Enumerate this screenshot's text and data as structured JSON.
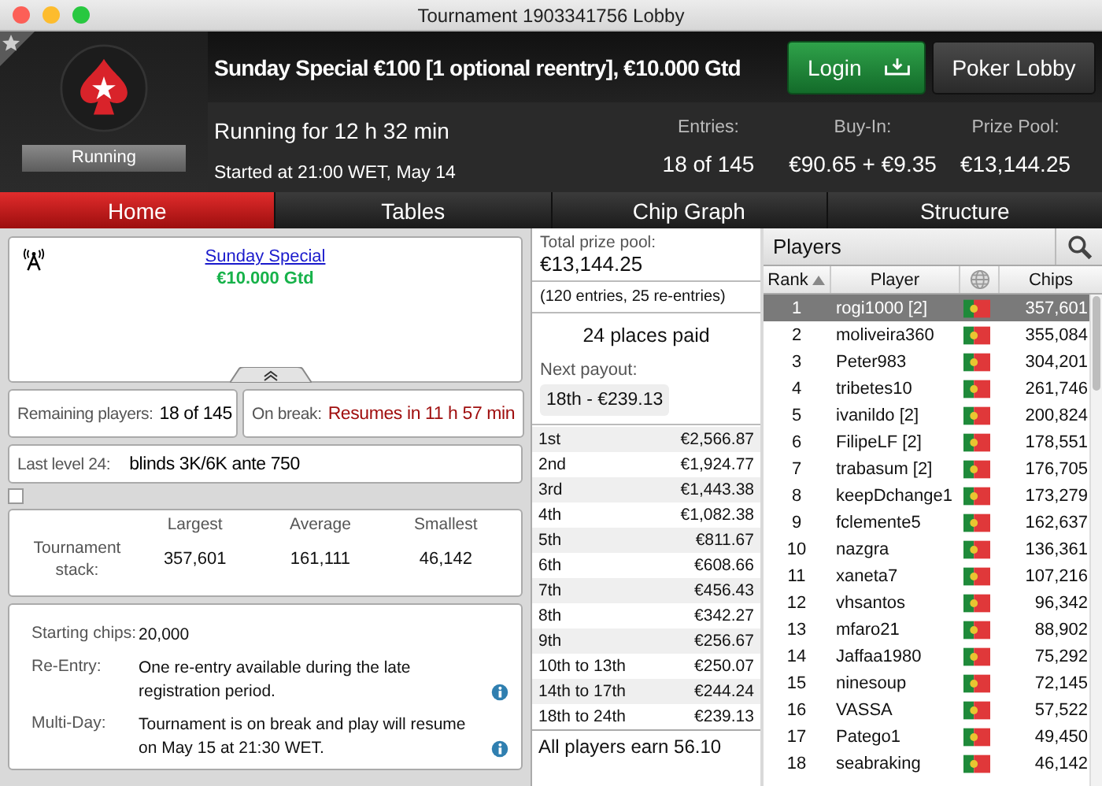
{
  "window": {
    "title": "Tournament 1903341756 Lobby"
  },
  "header": {
    "title": "Sunday Special €100 [1 optional reentry], €10.000 Gtd",
    "status_badge": "Running",
    "running_for": "Running for 12 h 32 min",
    "started": "Started at 21:00 WET, May 14",
    "login_button": "Login",
    "lobby_button": "Poker Lobby",
    "stats": [
      {
        "label": "Entries:",
        "value": "18 of 145"
      },
      {
        "label": "Buy-In:",
        "value": "€90.65 + €9.35"
      },
      {
        "label": "Prize Pool:",
        "value": "€13,144.25"
      }
    ]
  },
  "tabs": [
    {
      "label": "Home",
      "selected": true
    },
    {
      "label": "Tables",
      "selected": false
    },
    {
      "label": "Chip Graph",
      "selected": false
    },
    {
      "label": "Structure",
      "selected": false
    }
  ],
  "banner": {
    "link": "Sunday Special",
    "guarantee": "€10.000 Gtd"
  },
  "remaining": {
    "label": "Remaining players:",
    "value": "18 of 145"
  },
  "on_break": {
    "label": "On break:",
    "value": "Resumes in 11 h 57 min"
  },
  "last_level": {
    "label": "Last level 24:",
    "value": "blinds 3K/6K ante 750"
  },
  "stack_toggle": {
    "checked": false
  },
  "stack": {
    "row_label": "Tournament stack:",
    "columns": [
      "Largest",
      "Average",
      "Smallest"
    ],
    "values": [
      "357,601",
      "161,111",
      "46,142"
    ]
  },
  "details": [
    {
      "label": "Starting chips:",
      "value": "20,000",
      "info": false
    },
    {
      "label": "Re-Entry:",
      "value": "One re-entry available during the late registration period.",
      "info": true
    },
    {
      "label": "Multi-Day:",
      "value": "Tournament is on break and play will resume on May 15 at 21:30 WET.",
      "info": true
    }
  ],
  "prize": {
    "total_label": "Total prize pool:",
    "total_value": "€13,144.25",
    "entries_note": "(120 entries, 25 re-entries)",
    "places_paid": "24 places paid",
    "next_payout_label": "Next payout:",
    "next_payout_value": "18th - €239.13",
    "payouts": [
      {
        "place": "1st",
        "amount": "€2,566.87"
      },
      {
        "place": "2nd",
        "amount": "€1,924.77"
      },
      {
        "place": "3rd",
        "amount": "€1,443.38"
      },
      {
        "place": "4th",
        "amount": "€1,082.38"
      },
      {
        "place": "5th",
        "amount": "€811.67"
      },
      {
        "place": "6th",
        "amount": "€608.66"
      },
      {
        "place": "7th",
        "amount": "€456.43"
      },
      {
        "place": "8th",
        "amount": "€342.27"
      },
      {
        "place": "9th",
        "amount": "€256.67"
      },
      {
        "place": "10th to 13th",
        "amount": "€250.07"
      },
      {
        "place": "14th to 17th",
        "amount": "€244.24"
      },
      {
        "place": "18th to 24th",
        "amount": "€239.13"
      }
    ],
    "footer": "All players earn 56.10"
  },
  "players": {
    "title": "Players",
    "columns": [
      {
        "label": "Rank",
        "sorted": true
      },
      {
        "label": "Player",
        "sorted": false
      },
      {
        "label": "Chips",
        "sorted": false
      }
    ],
    "rows": [
      {
        "rank": "1",
        "player": "rogi1000 [2]",
        "chips": "357,601",
        "selected": true
      },
      {
        "rank": "2",
        "player": "moliveira360",
        "chips": "355,084",
        "selected": false
      },
      {
        "rank": "3",
        "player": "Peter983",
        "chips": "304,201",
        "selected": false
      },
      {
        "rank": "4",
        "player": "tribetes10",
        "chips": "261,746",
        "selected": false
      },
      {
        "rank": "5",
        "player": "ivanildo [2]",
        "chips": "200,824",
        "selected": false
      },
      {
        "rank": "6",
        "player": "FilipeLF [2]",
        "chips": "178,551",
        "selected": false
      },
      {
        "rank": "7",
        "player": "trabasum [2]",
        "chips": "176,705",
        "selected": false
      },
      {
        "rank": "8",
        "player": "keepDchange1",
        "chips": "173,279",
        "selected": false
      },
      {
        "rank": "9",
        "player": "fclemente5",
        "chips": "162,637",
        "selected": false
      },
      {
        "rank": "10",
        "player": "nazgra",
        "chips": "136,361",
        "selected": false
      },
      {
        "rank": "11",
        "player": "xaneta7",
        "chips": "107,216",
        "selected": false
      },
      {
        "rank": "12",
        "player": "vhsantos",
        "chips": "96,342",
        "selected": false
      },
      {
        "rank": "13",
        "player": "mfaro21",
        "chips": "88,902",
        "selected": false
      },
      {
        "rank": "14",
        "player": "Jaffaa1980",
        "chips": "75,292",
        "selected": false
      },
      {
        "rank": "15",
        "player": "ninesoup",
        "chips": "72,145",
        "selected": false
      },
      {
        "rank": "16",
        "player": "VASSA",
        "chips": "57,522",
        "selected": false
      },
      {
        "rank": "17",
        "player": "Patego1",
        "chips": "49,450",
        "selected": false
      },
      {
        "rank": "18",
        "player": "seabraking",
        "chips": "46,142",
        "selected": false
      }
    ]
  }
}
